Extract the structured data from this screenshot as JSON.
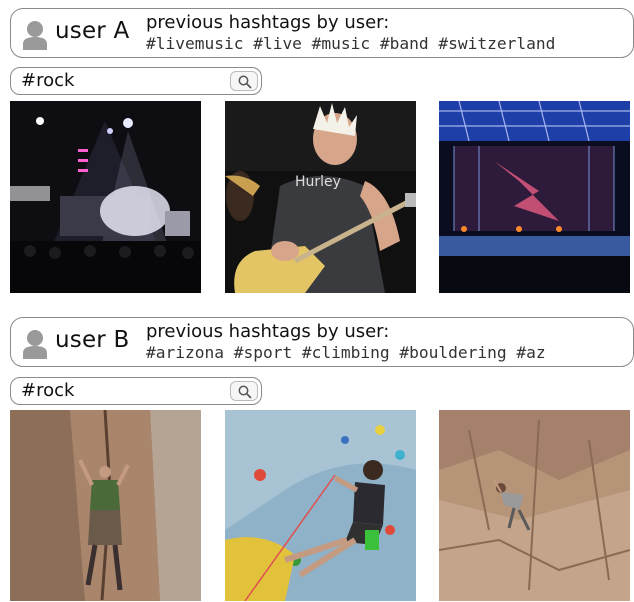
{
  "panels": [
    {
      "user_label": "user A",
      "prev_label": "previous hashtags by user:",
      "prev_hashtags": "#livemusic #live #music #band #switzerland",
      "search_query": "#rock",
      "results": [
        {
          "icon": "concert-stage-photo"
        },
        {
          "icon": "guitarist-photo"
        },
        {
          "icon": "arena-stage-photo"
        }
      ]
    },
    {
      "user_label": "user B",
      "prev_label": "previous hashtags by user:",
      "prev_hashtags": "#arizona #sport #climbing #bouldering #az",
      "search_query": "#rock",
      "results": [
        {
          "icon": "rock-climber-photo"
        },
        {
          "icon": "climbing-wall-photo"
        },
        {
          "icon": "cliff-climber-photo"
        }
      ]
    }
  ],
  "colors": {
    "border": "#8a8a8a",
    "avatar": "#9a9a9a",
    "concert_dark": "#0d0d12",
    "stage_blue": "#1f3fa8",
    "rock_tan": "#b69478",
    "wall_blue": "#8fb2c8"
  },
  "icons": {
    "avatar": "user-avatar-icon",
    "search": "magnifier-icon"
  }
}
